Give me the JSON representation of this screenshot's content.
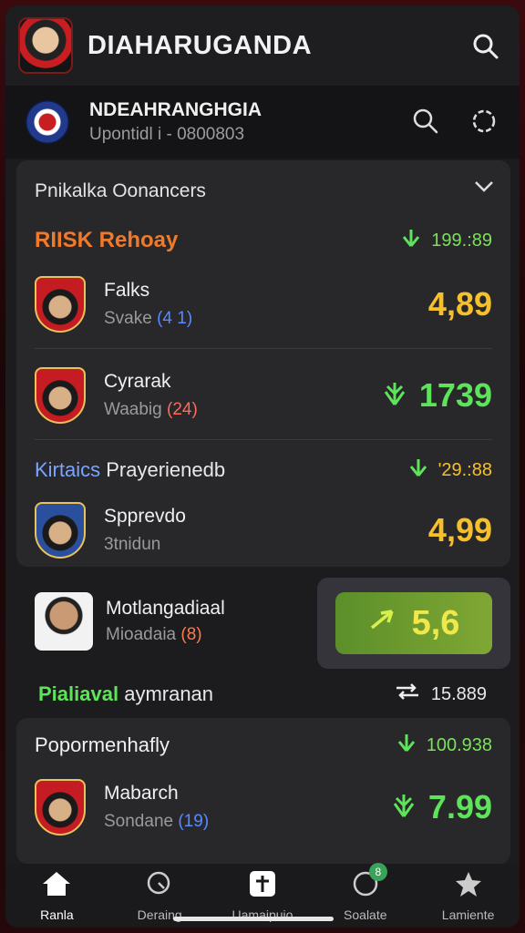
{
  "app": {
    "title": "DIAHARUGANDA"
  },
  "subheader": {
    "title": "NDEAHRANGHGIA",
    "meta": "Upontidl i - 0800803"
  },
  "section1": {
    "title": "Pnikalka Oonancers",
    "group1": {
      "label": "RIISK Rehoay",
      "value": "199.:89",
      "color": "#f07a2a"
    },
    "players": [
      {
        "name": "Falks",
        "sub": "Svake",
        "tag": "(4 1)",
        "score": "4,89"
      },
      {
        "name": "Cyrarak",
        "sub": "Waabig",
        "tag": "(24)",
        "score": "1739"
      }
    ],
    "group2": {
      "label_a": "Kirtaics",
      "label_b": "Prayerienedb",
      "value": "'29.:88"
    },
    "player3": {
      "name": "Spprevdo",
      "sub": "3tnidun",
      "score": "4,99"
    }
  },
  "feature": {
    "name": "Motlangadiaal",
    "sub": "Mioadaia",
    "tag": "(8)",
    "score": "5,6",
    "stat_label_a": "Pialiaval",
    "stat_label_b": "aymranan",
    "stat_value": "15.889"
  },
  "section2": {
    "title": "Popormenhafly",
    "value": "100.938",
    "player": {
      "name": "Mabarch",
      "sub": "Sondane",
      "tag": "(19)",
      "score": "7.99"
    }
  },
  "nav": [
    {
      "label": "Ranla",
      "icon": "home-icon"
    },
    {
      "label": "Deraing",
      "icon": "search-icon"
    },
    {
      "label": "Uamaipuio",
      "icon": "add-icon"
    },
    {
      "label": "Soalate",
      "icon": "chat-icon",
      "badge": "8"
    },
    {
      "label": "Lamiente",
      "icon": "star-icon"
    }
  ],
  "colors": {
    "accent_green": "#5ee45a",
    "score_gold": "#f6c02c",
    "brand_red": "#c81e22"
  }
}
